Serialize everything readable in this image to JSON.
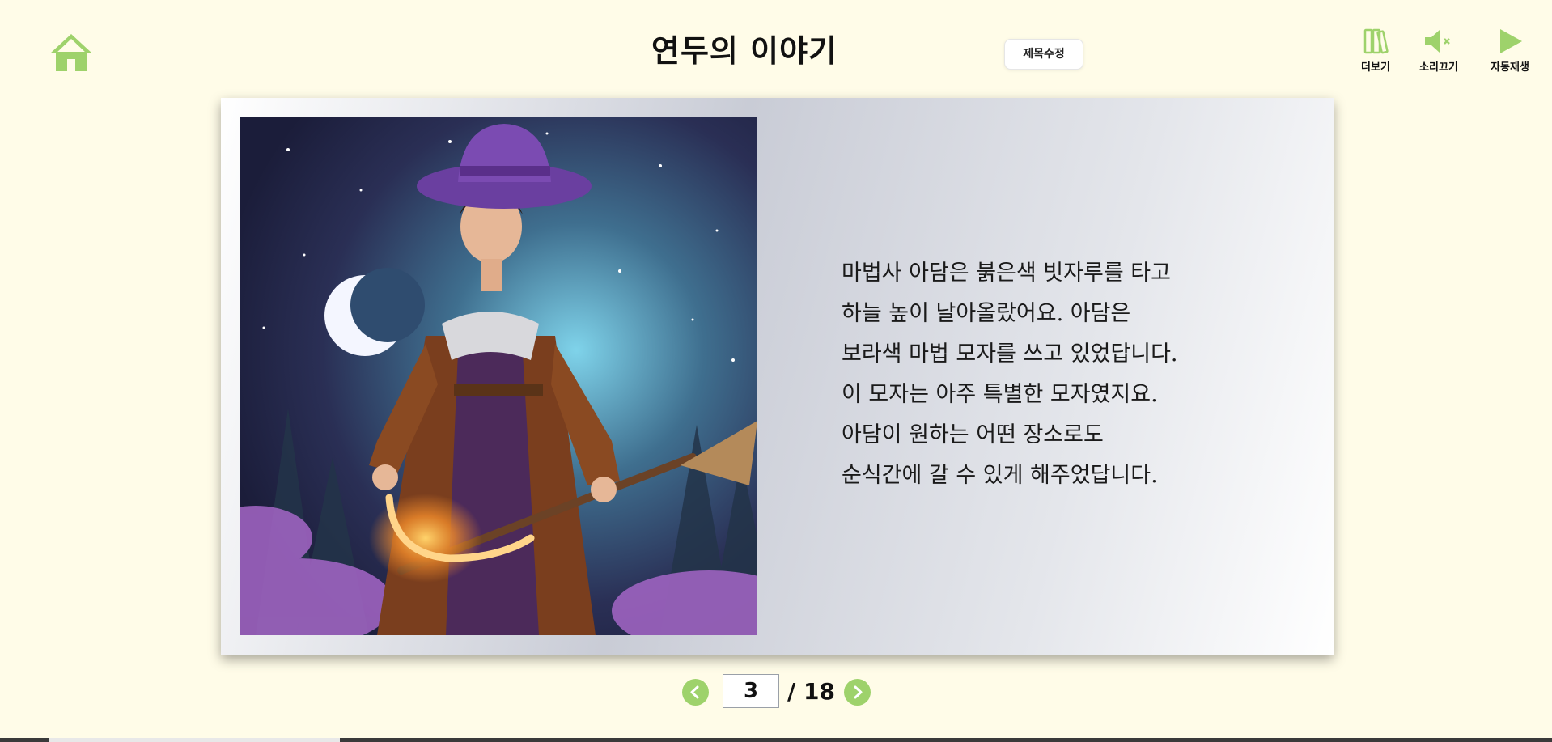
{
  "header": {
    "home_icon": "home-icon",
    "title": "연두의 이야기",
    "edit_title_label": "제목수정"
  },
  "tools": [
    {
      "icon": "books-icon",
      "label": "더보기"
    },
    {
      "icon": "speaker-mute-icon",
      "label": "소리끄기"
    },
    {
      "icon": "play-icon",
      "label": "자동재생"
    }
  ],
  "page": {
    "image_icon": "wizard-illustration",
    "text_lines": [
      "마법사 아담은 붉은색 빗자루를 타고",
      "하늘 높이 날아올랐어요. 아담은",
      "보라색 마법 모자를 쓰고 있었답니다.",
      "이 모자는 아주 특별한 모자였지요.",
      "아담이 원하는 어떤 장소로도",
      "순식간에 갈 수 있게 해주었답니다."
    ]
  },
  "pagination": {
    "current": "3",
    "total_label": "/ 18",
    "prev_icon": "chevron-left-icon",
    "next_icon": "chevron-right-icon"
  },
  "colors": {
    "background": "#fffce8",
    "accent_green": "#9ed26b"
  }
}
